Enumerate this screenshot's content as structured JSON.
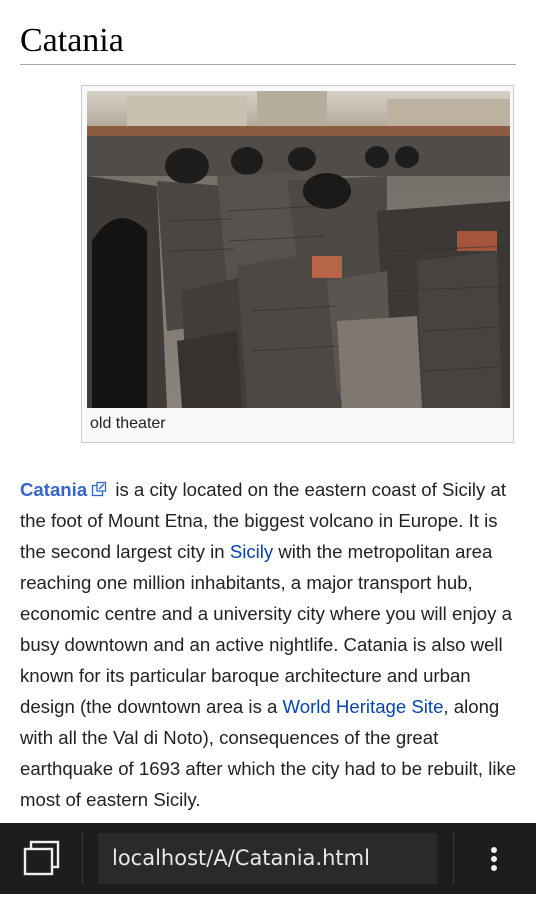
{
  "page": {
    "title": "Catania"
  },
  "figure": {
    "caption": "old theater"
  },
  "article": {
    "link_catania": "Catania",
    "text1": " is a city located on the eastern coast of Sicily at the foot of Mount Etna, the biggest volcano in Europe. It is the second largest city in ",
    "link_sicily": "Sicily",
    "text2": " with the metropolitan area reaching one million inhabitants, a major transport hub, economic centre and a university city where you will enjoy a busy downtown and an active nightlife. Catania is also well known for its particular baroque architecture and urban design (the downtown area is a ",
    "link_whs": "World Heritage Site",
    "text3": ", along with all the Val di Noto), consequences of the great earthquake of 1693 after which the city had to be rebuilt, like most of eastern Sicily."
  },
  "toolbar": {
    "url": "localhost/A/Catania.html",
    "tabs_icon": "tabs-icon",
    "menu_icon": "overflow-menu-icon"
  }
}
